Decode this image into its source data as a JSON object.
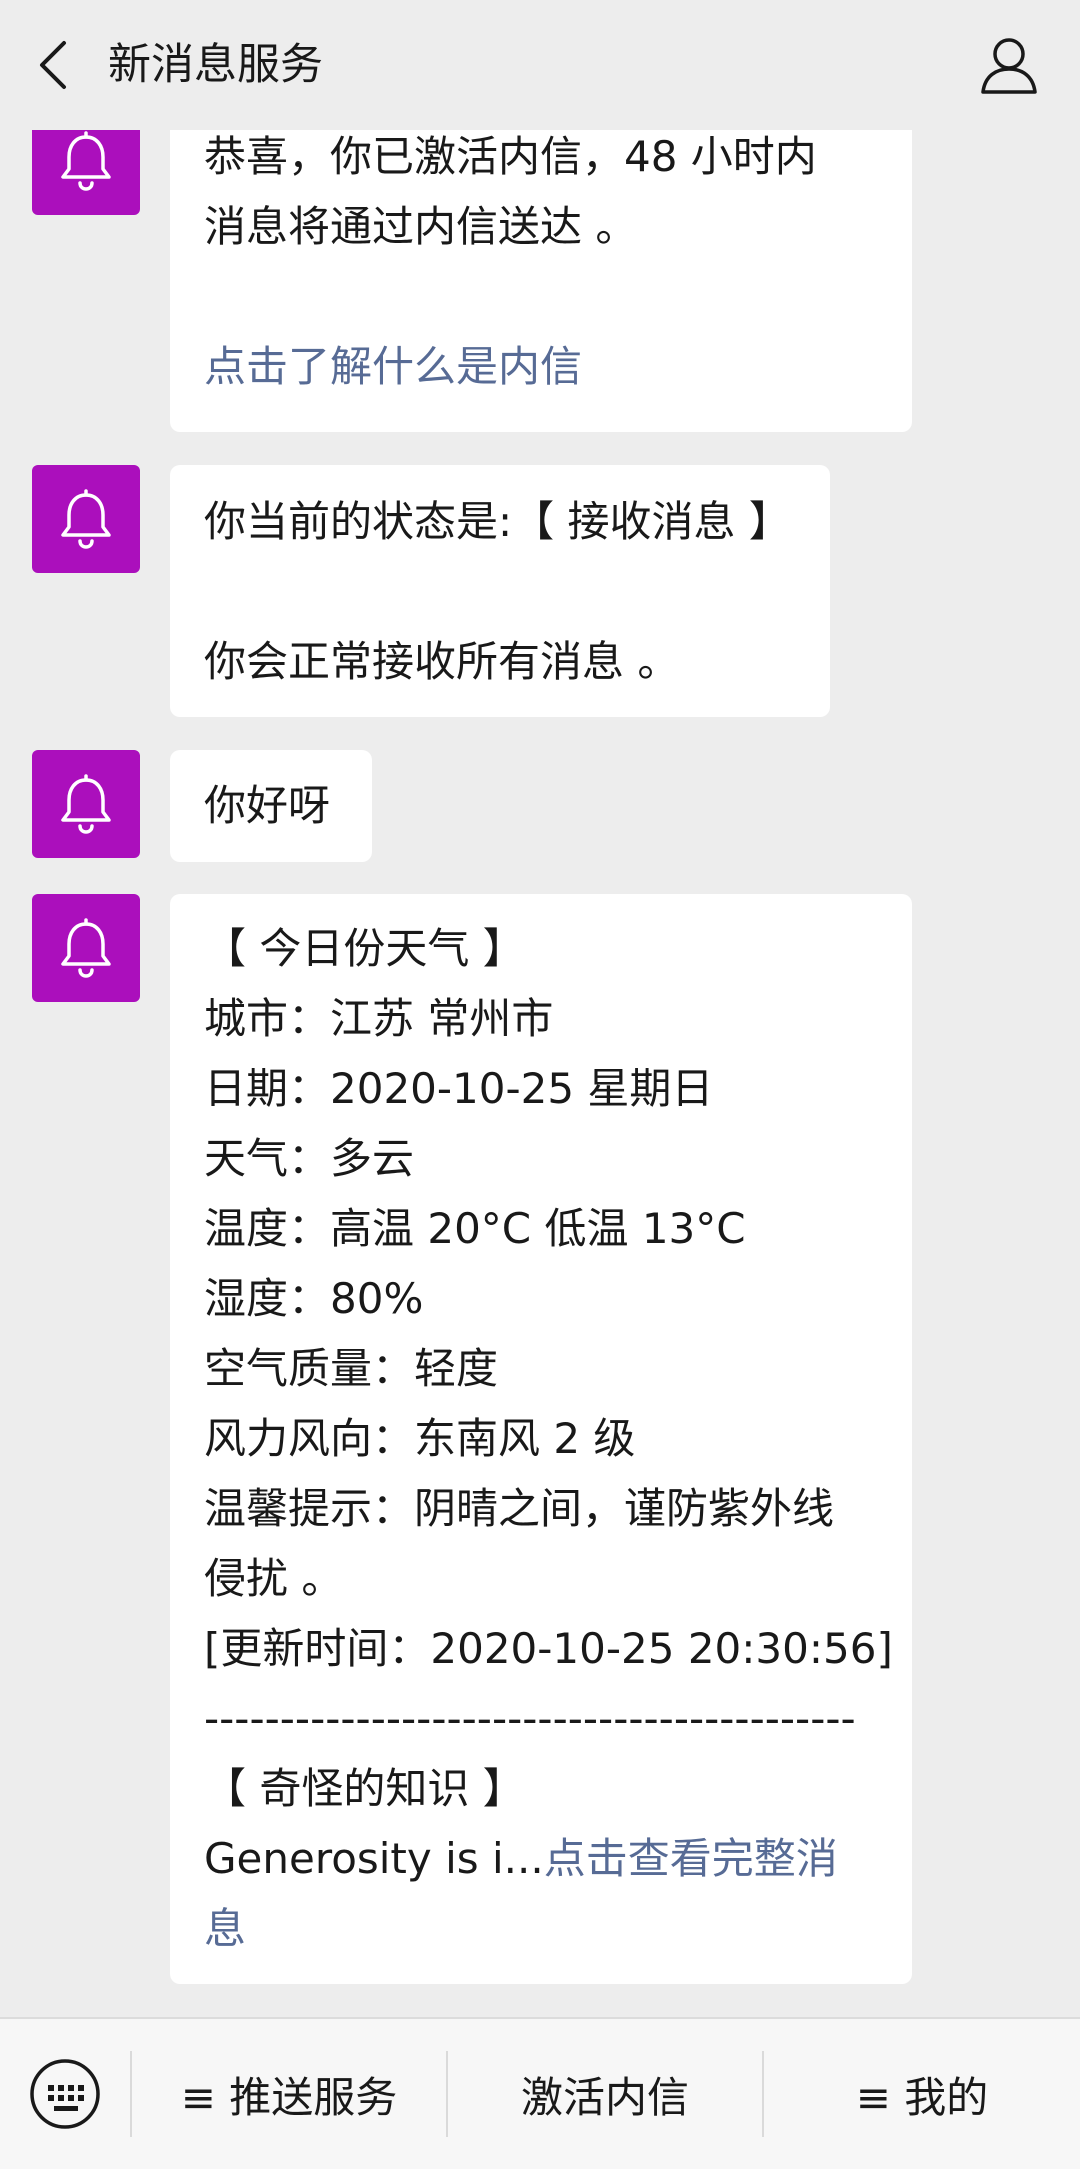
{
  "header": {
    "title": "新消息服务",
    "back_icon": "chevron-left-icon",
    "profile_icon": "user-icon"
  },
  "colors": {
    "avatar_bg": "#ab0fbc",
    "link": "#576b95",
    "background": "#ededed"
  },
  "messages": [
    {
      "lines": [
        "恭喜，你已激活内信，48 小时内",
        "消息将通过内信送达 。"
      ],
      "link": "点击了解什么是内信"
    },
    {
      "line1": "你当前的状态是:【 接收消息 】",
      "line2": "你会正常接收所有消息 。"
    },
    {
      "text": "你好呀"
    },
    {
      "lines": [
        "【 今日份天气 】",
        "城市：江苏 常州市",
        "日期：2020-10-25 星期日",
        "天气：多云",
        "温度：高温 20°C 低温 13°C",
        "湿度：80%",
        "空气质量：轻度",
        "风力风向：东南风 2 级",
        "温馨提示：阴晴之间，谨防紫外线",
        "侵扰 。",
        "[更新时间：2020-10-25 20:30:56]",
        "-------------------------------------------",
        "【 奇怪的知识 】"
      ],
      "preview": "Generosity is i...",
      "link_part1": "点击查看完整消",
      "link_part2": "息"
    }
  ],
  "bottom_menu": {
    "keyboard_icon": "keyboard-icon",
    "items": [
      "≡ 推送服务",
      "激活内信",
      "≡ 我的"
    ]
  }
}
